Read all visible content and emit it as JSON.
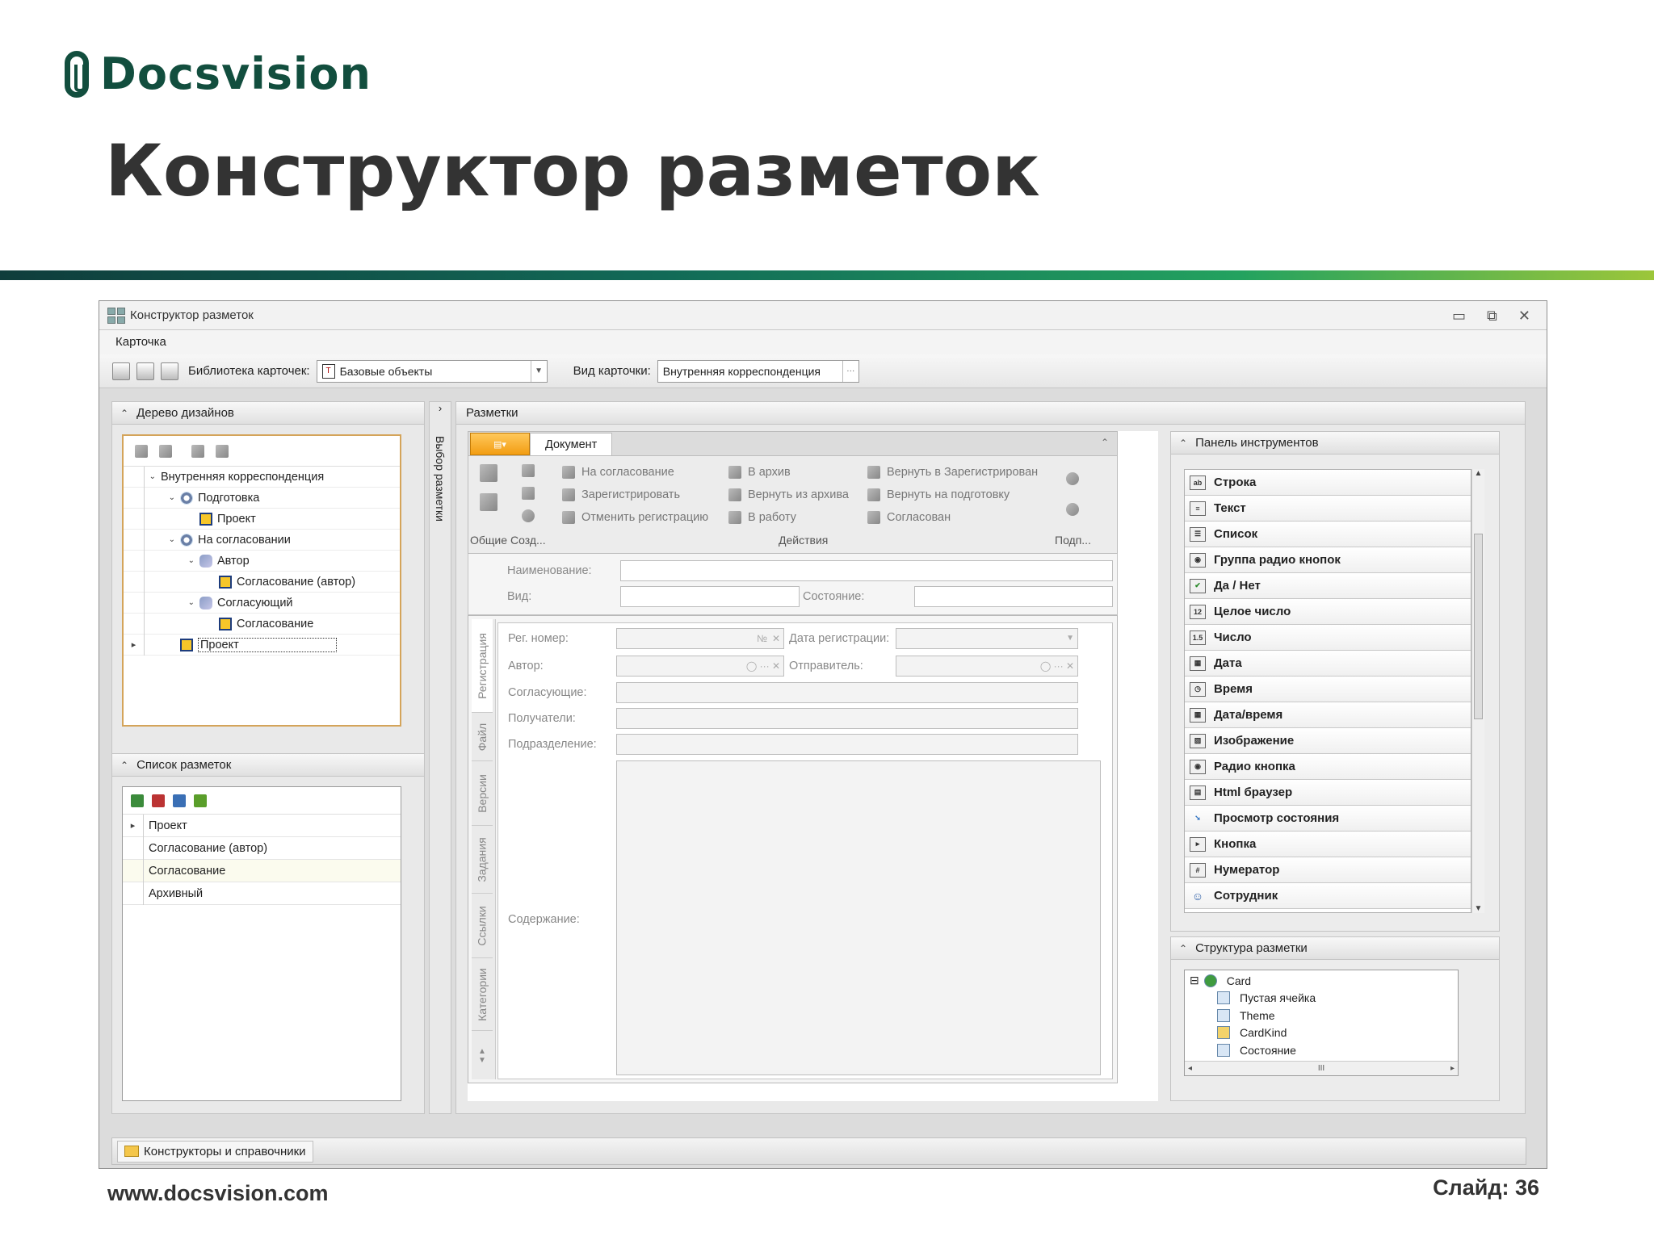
{
  "brand": {
    "name": "Docsvision"
  },
  "slide": {
    "title": "Конструктор разметок",
    "url": "www.docsvision.com",
    "number": "Слайд: 36",
    "stripe_colors": [
      "#0f3d3c",
      "#126a57",
      "#23a25f",
      "#9cc63a"
    ]
  },
  "window": {
    "title": "Конструктор разметок",
    "controls": [
      "minimize-icon",
      "restore-icon",
      "close-icon"
    ],
    "menu": {
      "card": "Карточка"
    },
    "toolbar": {
      "library_label": "Библиотека карточек:",
      "library_value": "Базовые объекты",
      "kind_label": "Вид карточки:",
      "kind_value": "Внутренняя корреспонденция",
      "kind_more": "···"
    },
    "design_tree": {
      "title": "Дерево дизайнов",
      "items": [
        {
          "label": "Внутренняя корреспонденция",
          "level": 0
        },
        {
          "label": "Подготовка",
          "level": 1
        },
        {
          "label": "Проект",
          "level": 2
        },
        {
          "label": "На согласовании",
          "level": 1
        },
        {
          "label": "Автор",
          "level": 2
        },
        {
          "label": "Согласование (автор)",
          "level": 3
        },
        {
          "label": "Согласующий",
          "level": 2
        },
        {
          "label": "Согласование",
          "level": 3
        },
        {
          "label": "Проект",
          "level": 1
        }
      ]
    },
    "side_tab": {
      "label": "Выбор разметки"
    },
    "layouts_list": {
      "title": "Список разметок",
      "items": [
        "Проект",
        "Согласование (автор)",
        "Согласование",
        "Архивный"
      ]
    },
    "bottom_bar": {
      "label": "Конструкторы и справочники"
    },
    "layouts_area": {
      "title": "Разметки",
      "ribbon": {
        "tab": "Документ",
        "actions_col1": [
          "На согласование",
          "Зарегистрировать",
          "Отменить регистрацию"
        ],
        "actions_col2": [
          "В архив",
          "Вернуть из архива",
          "В работу"
        ],
        "actions_col3": [
          "Вернуть в Зарегистрирован",
          "Вернуть на подготовку",
          "Согласован"
        ],
        "groups": [
          "Общие",
          "Созд...",
          "Действия",
          "Подп..."
        ]
      },
      "form": {
        "name_label": "Наименование:",
        "kind_label": "Вид:",
        "state_label": "Состояние:",
        "tabs": [
          "Регистрация",
          "Файл",
          "Версии",
          "Задания",
          "Ссылки",
          "Категории"
        ],
        "reg_number": "Рег. номер:",
        "reg_number_suffix": "№",
        "reg_date": "Дата регистрации:",
        "author": "Автор:",
        "sender": "Отправитель:",
        "approvers": "Согласующие:",
        "recipients": "Получатели:",
        "department": "Подразделение:",
        "content": "Содержание:"
      }
    },
    "toolbox": {
      "title": "Панель инструментов",
      "items": [
        {
          "label": "Строка",
          "icon": "string-icon"
        },
        {
          "label": "Текст",
          "icon": "text-icon"
        },
        {
          "label": "Список",
          "icon": "list-icon"
        },
        {
          "label": "Группа радио кнопок",
          "icon": "radio-group-icon"
        },
        {
          "label": "Да / Нет",
          "icon": "checkbox-icon"
        },
        {
          "label": "Целое число",
          "icon": "integer-icon"
        },
        {
          "label": "Число",
          "icon": "number-icon"
        },
        {
          "label": "Дата",
          "icon": "date-icon"
        },
        {
          "label": "Время",
          "icon": "time-icon"
        },
        {
          "label": "Дата/время",
          "icon": "datetime-icon"
        },
        {
          "label": "Изображение",
          "icon": "image-icon"
        },
        {
          "label": "Радио кнопка",
          "icon": "radio-icon"
        },
        {
          "label": "Html браузер",
          "icon": "browser-icon"
        },
        {
          "label": "Просмотр состояния",
          "icon": "state-view-icon"
        },
        {
          "label": "Кнопка",
          "icon": "button-icon"
        },
        {
          "label": "Нумератор",
          "icon": "numerator-icon"
        },
        {
          "label": "Сотрудник",
          "icon": "employee-icon"
        }
      ]
    },
    "structure": {
      "title": "Структура разметки",
      "items": [
        "Card",
        "Пустая ячейка",
        "Theme",
        "CardKind",
        "Состояние"
      ],
      "scroll_mark": "III"
    }
  }
}
